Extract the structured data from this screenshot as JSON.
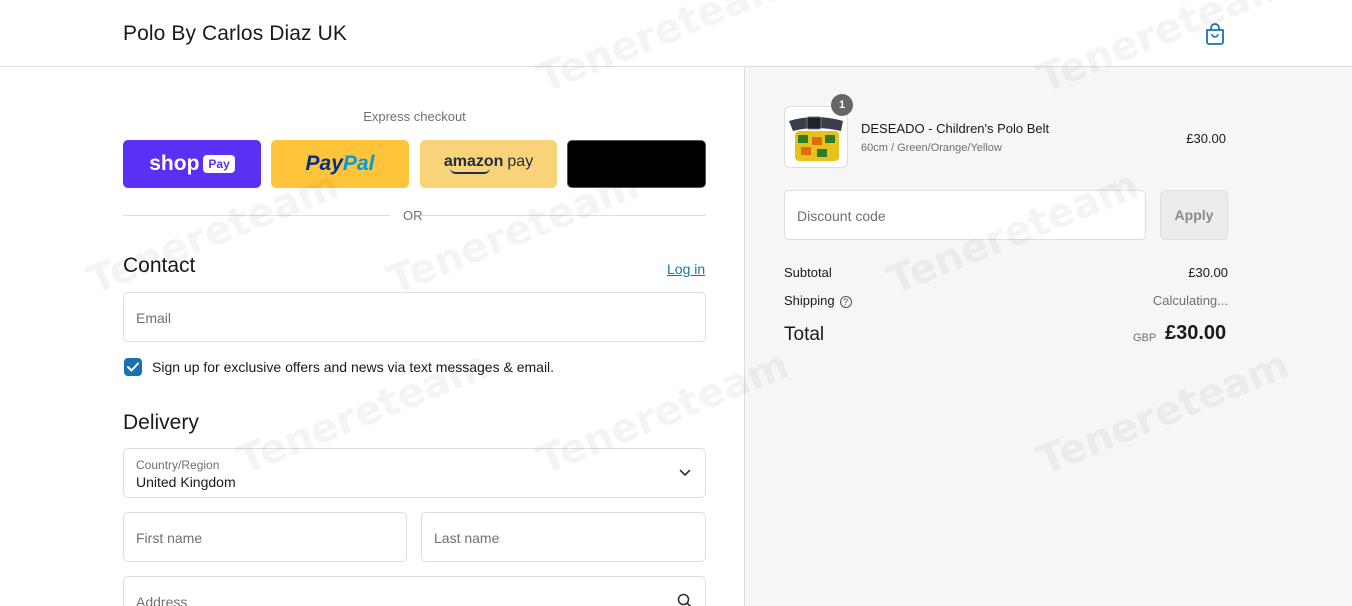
{
  "header": {
    "brand": "Polo By Carlos Diaz UK"
  },
  "express": {
    "label": "Express checkout",
    "shop_pay": {
      "shop": "shop",
      "pay": "Pay"
    },
    "paypal": {
      "p1": "Pay",
      "p2": "Pal"
    },
    "amazon": {
      "amazon": "amazon",
      "pay": "pay"
    },
    "or": "OR"
  },
  "contact": {
    "title": "Contact",
    "login": "Log in",
    "email_placeholder": "Email",
    "signup_label": "Sign up for exclusive offers and news via text messages & email.",
    "signup_checked": true
  },
  "delivery": {
    "title": "Delivery",
    "country_label": "Country/Region",
    "country_value": "United Kingdom",
    "first_name_placeholder": "First name",
    "last_name_placeholder": "Last name",
    "address_placeholder": "Address"
  },
  "summary": {
    "item": {
      "quantity": "1",
      "name": "DESEADO - Children's Polo Belt",
      "variant": "60cm / Green/Orange/Yellow",
      "price": "£30.00"
    },
    "discount_placeholder": "Discount code",
    "apply_label": "Apply",
    "subtotal_label": "Subtotal",
    "subtotal_value": "£30.00",
    "shipping_label": "Shipping",
    "shipping_value": "Calculating...",
    "total_label": "Total",
    "currency": "GBP",
    "total_value": "£30.00"
  },
  "watermark": "Tenereteam",
  "colors": {
    "accent": "#1773b0",
    "shop_pay": "#5a31f4",
    "paypal": "#ffc439",
    "amazon": "#f8d37a"
  }
}
